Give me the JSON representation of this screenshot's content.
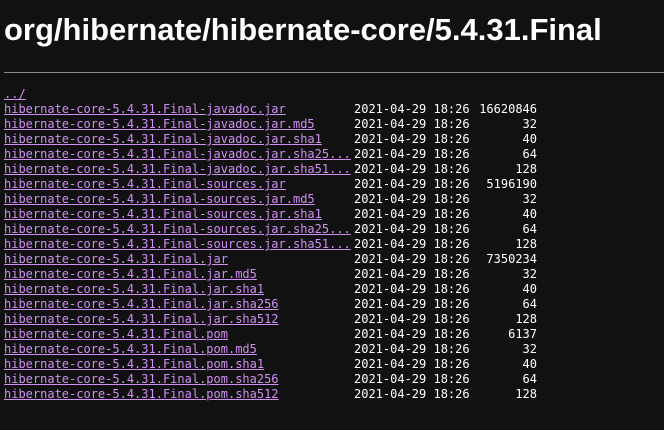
{
  "title": "org/hibernate/hibernate-core/5.4.31.Final",
  "parent_link": "../",
  "files": [
    {
      "name": "hibernate-core-5.4.31.Final-javadoc.jar",
      "date": "2021-04-29 18:26",
      "size": "16620846"
    },
    {
      "name": "hibernate-core-5.4.31.Final-javadoc.jar.md5",
      "date": "2021-04-29 18:26",
      "size": "32"
    },
    {
      "name": "hibernate-core-5.4.31.Final-javadoc.jar.sha1",
      "date": "2021-04-29 18:26",
      "size": "40"
    },
    {
      "name": "hibernate-core-5.4.31.Final-javadoc.jar.sha25...",
      "date": "2021-04-29 18:26",
      "size": "64"
    },
    {
      "name": "hibernate-core-5.4.31.Final-javadoc.jar.sha51...",
      "date": "2021-04-29 18:26",
      "size": "128"
    },
    {
      "name": "hibernate-core-5.4.31.Final-sources.jar",
      "date": "2021-04-29 18:26",
      "size": "5196190"
    },
    {
      "name": "hibernate-core-5.4.31.Final-sources.jar.md5",
      "date": "2021-04-29 18:26",
      "size": "32"
    },
    {
      "name": "hibernate-core-5.4.31.Final-sources.jar.sha1",
      "date": "2021-04-29 18:26",
      "size": "40"
    },
    {
      "name": "hibernate-core-5.4.31.Final-sources.jar.sha25...",
      "date": "2021-04-29 18:26",
      "size": "64"
    },
    {
      "name": "hibernate-core-5.4.31.Final-sources.jar.sha51...",
      "date": "2021-04-29 18:26",
      "size": "128"
    },
    {
      "name": "hibernate-core-5.4.31.Final.jar",
      "date": "2021-04-29 18:26",
      "size": "7350234"
    },
    {
      "name": "hibernate-core-5.4.31.Final.jar.md5",
      "date": "2021-04-29 18:26",
      "size": "32"
    },
    {
      "name": "hibernate-core-5.4.31.Final.jar.sha1",
      "date": "2021-04-29 18:26",
      "size": "40"
    },
    {
      "name": "hibernate-core-5.4.31.Final.jar.sha256",
      "date": "2021-04-29 18:26",
      "size": "64"
    },
    {
      "name": "hibernate-core-5.4.31.Final.jar.sha512",
      "date": "2021-04-29 18:26",
      "size": "128"
    },
    {
      "name": "hibernate-core-5.4.31.Final.pom",
      "date": "2021-04-29 18:26",
      "size": "6137"
    },
    {
      "name": "hibernate-core-5.4.31.Final.pom.md5",
      "date": "2021-04-29 18:26",
      "size": "32"
    },
    {
      "name": "hibernate-core-5.4.31.Final.pom.sha1",
      "date": "2021-04-29 18:26",
      "size": "40"
    },
    {
      "name": "hibernate-core-5.4.31.Final.pom.sha256",
      "date": "2021-04-29 18:26",
      "size": "64"
    },
    {
      "name": "hibernate-core-5.4.31.Final.pom.sha512",
      "date": "2021-04-29 18:26",
      "size": "128"
    }
  ],
  "colors": {
    "background": "#111111",
    "text": "#ffffff",
    "link": "#d08ff2",
    "rule": "#8a8a8a"
  }
}
